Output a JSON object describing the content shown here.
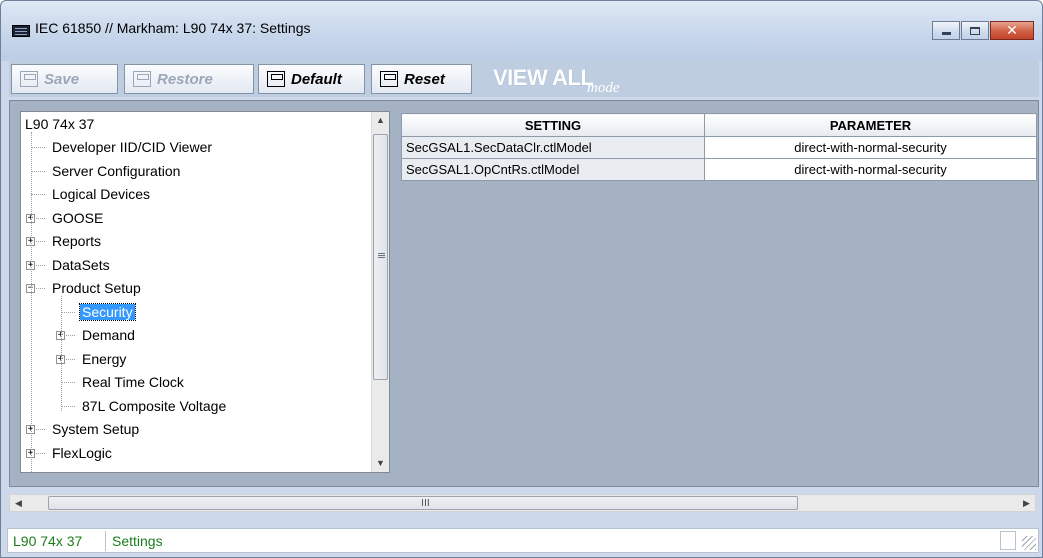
{
  "window": {
    "title": "IEC 61850 // Markham: L90 74x 37: Settings",
    "minimize": "▁",
    "maximize": "□",
    "close": "✕"
  },
  "toolbar": {
    "save_label": "Save",
    "restore_label": "Restore",
    "default_label": "Default",
    "reset_label": "Reset",
    "view_all_label": "VIEW ALL",
    "view_mode_label": "mode"
  },
  "tree": {
    "root": "L90 74x 37",
    "items": [
      {
        "label": "Developer IID/CID Viewer",
        "expander": "",
        "selected": false
      },
      {
        "label": "Server Configuration",
        "expander": "",
        "selected": false
      },
      {
        "label": "Logical Devices",
        "expander": "",
        "selected": false
      },
      {
        "label": "GOOSE",
        "expander": "+",
        "selected": false
      },
      {
        "label": "Reports",
        "expander": "+",
        "selected": false
      },
      {
        "label": "DataSets",
        "expander": "+",
        "selected": false
      },
      {
        "label": "Product Setup",
        "expander": "−",
        "selected": false
      },
      {
        "label": "Security",
        "expander": "",
        "selected": true
      },
      {
        "label": "Demand",
        "expander": "+",
        "selected": false
      },
      {
        "label": "Energy",
        "expander": "+",
        "selected": false
      },
      {
        "label": "Real Time Clock",
        "expander": "",
        "selected": false
      },
      {
        "label": "87L Composite Voltage",
        "expander": "",
        "selected": false
      },
      {
        "label": "System Setup",
        "expander": "+",
        "selected": false
      },
      {
        "label": "FlexLogic",
        "expander": "+",
        "selected": false
      }
    ],
    "scroll_up": "▲",
    "scroll_down": "▼"
  },
  "grid": {
    "columns": [
      "SETTING",
      "PARAMETER"
    ],
    "rows": [
      {
        "setting": "SecGSAL1.SecDataClr.ctlModel",
        "parameter": "direct-with-normal-security"
      },
      {
        "setting": "SecGSAL1.OpCntRs.ctlModel",
        "parameter": "direct-with-normal-security"
      }
    ]
  },
  "hscroll": {
    "left": "◀",
    "right": "▶",
    "grip": "III"
  },
  "status": {
    "device": "L90 74x 37",
    "view": "Settings"
  },
  "colors": {
    "selection": "#3399ff",
    "status_text": "#1c7c1c",
    "content_bg": "#a4b2c3"
  }
}
